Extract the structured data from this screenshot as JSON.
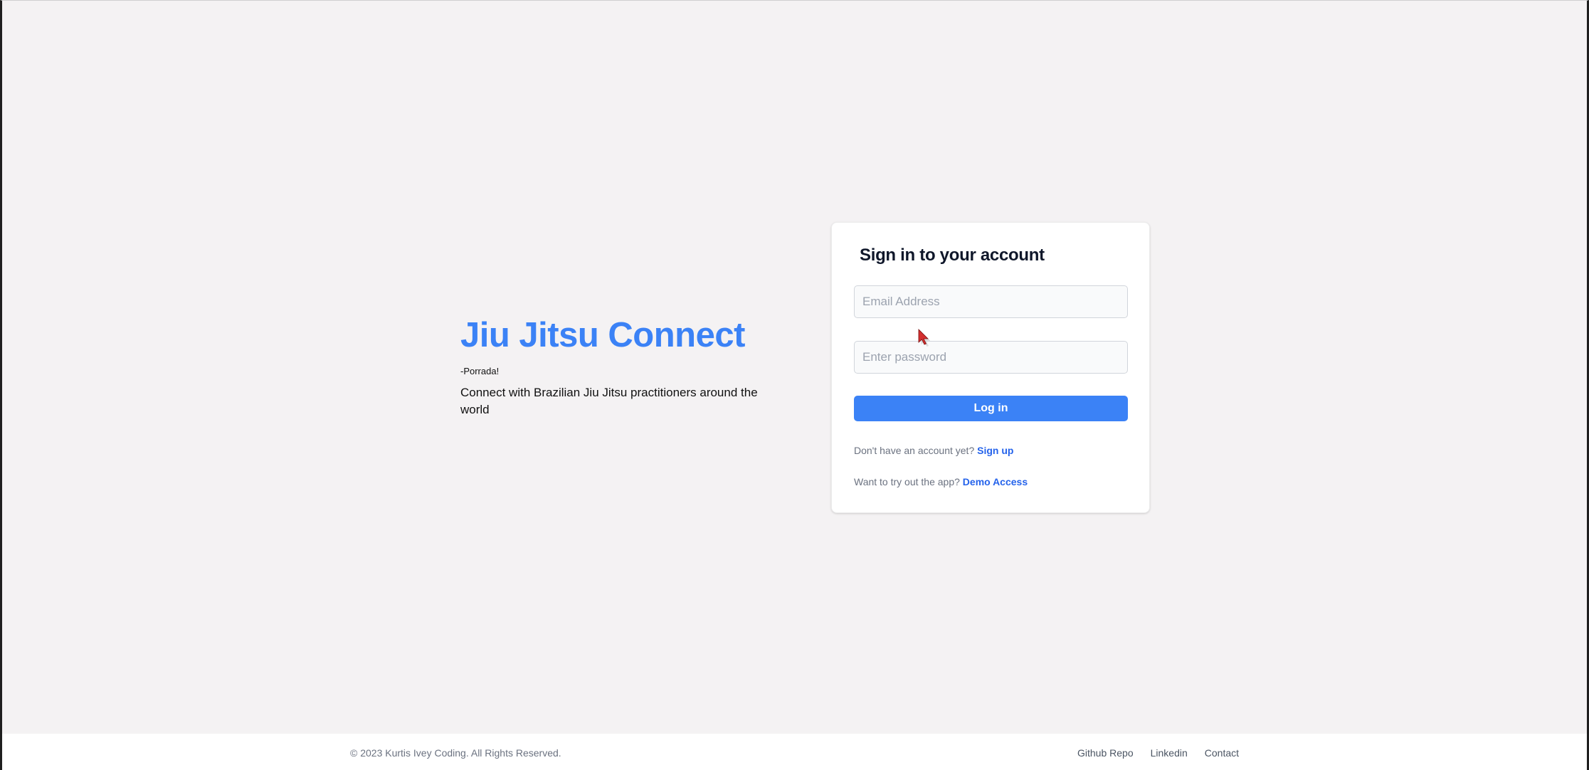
{
  "hero": {
    "title": "Jiu Jitsu Connect",
    "tagline": "-Porrada!",
    "description": "Connect with Brazilian Jiu Jitsu practitioners around the world"
  },
  "signin": {
    "heading": "Sign in to your account",
    "email_placeholder": "Email Address",
    "email_value": "",
    "password_placeholder": "Enter password",
    "password_value": "",
    "login_label": "Log in",
    "signup_prompt": "Don't have an account yet? ",
    "signup_link": "Sign up",
    "demo_prompt": "Want to try out the app? ",
    "demo_link": "Demo Access"
  },
  "footer": {
    "copyright": "© 2023 Kurtis Ivey Coding. All Rights Reserved.",
    "links": [
      "Github Repo",
      "Linkedin",
      "Contact"
    ]
  },
  "colors": {
    "accent": "#3b82f6",
    "link": "#2563eb",
    "background": "#f4f2f3",
    "cursor": "#d32f2f"
  },
  "icons": {
    "cursor": "mouse-pointer-icon"
  }
}
